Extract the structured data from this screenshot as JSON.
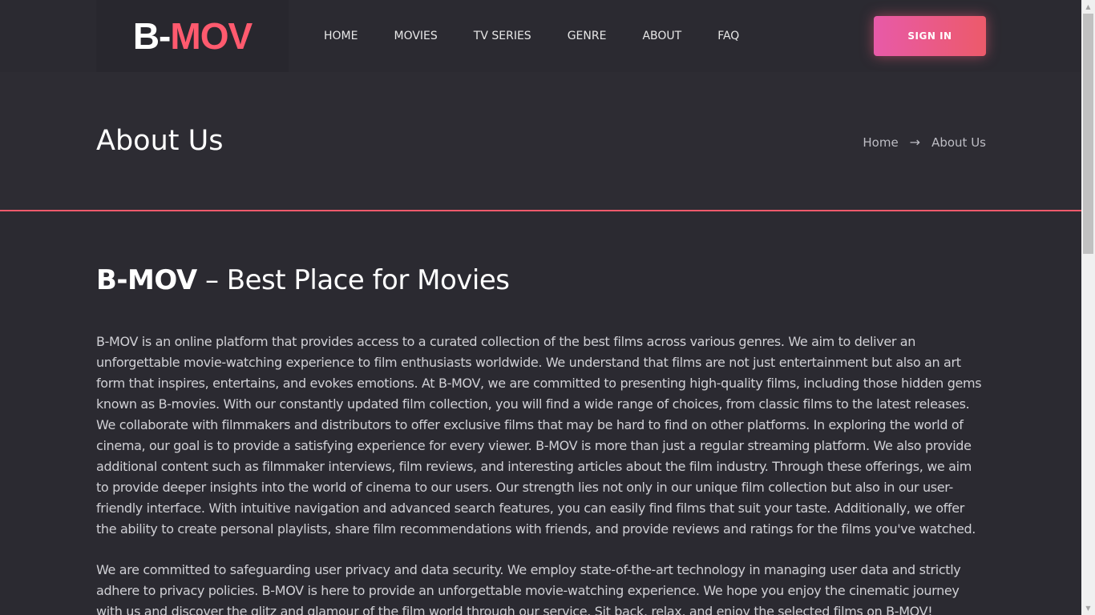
{
  "brand": {
    "part1": "B-",
    "part2": "MOV"
  },
  "nav": [
    "HOME",
    "MOVIES",
    "TV SERIES",
    "GENRE",
    "ABOUT",
    "FAQ"
  ],
  "signin_label": "SIGN IN",
  "banner": {
    "title": "About Us",
    "breadcrumb": {
      "home": "Home",
      "current": "About Us"
    }
  },
  "content": {
    "headline_bold": "B-MOV",
    "headline_rest": " – Best Place for Movies",
    "paragraph1": "B-MOV is an online platform that provides access to a curated collection of the best films across various genres. We aim to deliver an unforgettable movie-watching experience to film enthusiasts worldwide. We understand that films are not just entertainment but also an art form that inspires, entertains, and evokes emotions. At B-MOV, we are committed to presenting high-quality films, including those hidden gems known as B-movies. With our constantly updated film collection, you will find a wide range of choices, from classic films to the latest releases. We collaborate with filmmakers and distributors to offer exclusive films that may be hard to find on other platforms. In exploring the world of cinema, our goal is to provide a satisfying experience for every viewer. B-MOV is more than just a regular streaming platform. We also provide additional content such as filmmaker interviews, film reviews, and interesting articles about the film industry. Through these offerings, we aim to provide deeper insights into the world of cinema to our users. Our strength lies not only in our unique film collection but also in our user-friendly interface. With intuitive navigation and advanced search features, you can easily find films that suit your taste. Additionally, we offer the ability to create personal playlists, share film recommendations with friends, and provide reviews and ratings for the films you've watched.",
    "paragraph2": "We are committed to safeguarding user privacy and data security. We employ state-of-the-art technology in managing user data and strictly adhere to privacy policies. B-MOV is here to provide an unforgettable movie-watching experience. We hope you enjoy the cinematic journey with us and discover the glitz and glamour of the film world through our service. Sit back, relax, and enjoy the selected films on B-MOV!"
  },
  "colors": {
    "background": "#2b2a31",
    "accent": "#ff5a6e",
    "button_gradient_start": "#e85aa8",
    "button_gradient_end": "#ec5a6a"
  }
}
